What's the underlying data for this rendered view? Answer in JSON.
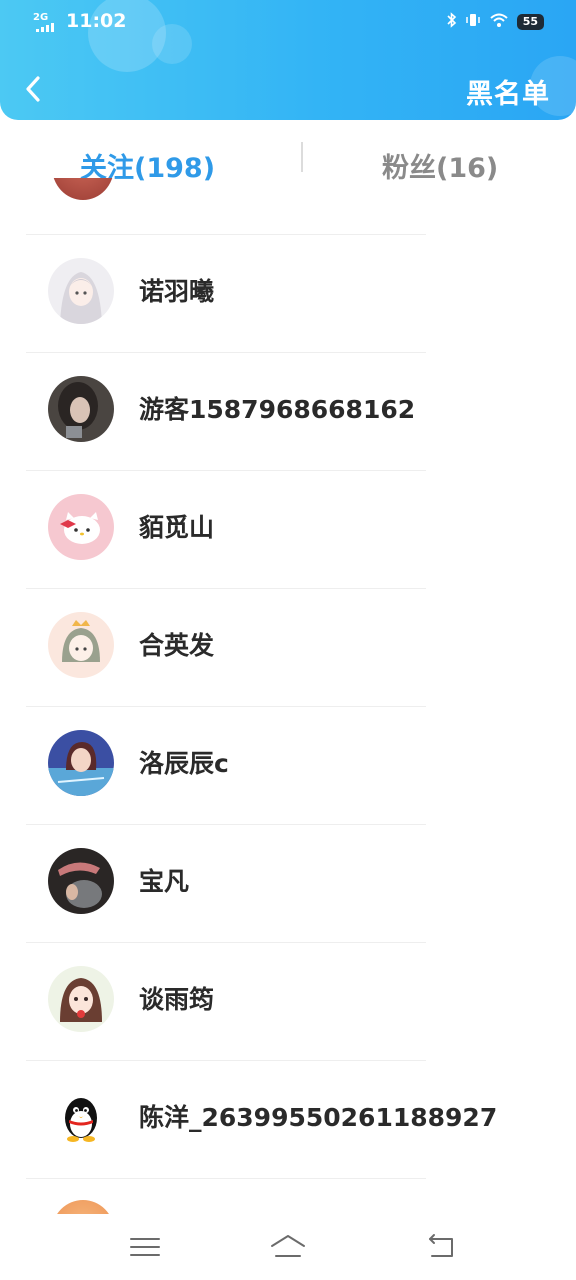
{
  "status_bar": {
    "network": "2G",
    "time": "11:02",
    "battery": "55",
    "icons": [
      "bluetooth-icon",
      "vibrate-icon",
      "wifi-icon",
      "battery-icon"
    ]
  },
  "header": {
    "back_icon": "chevron-left-icon",
    "blacklist_label": "黑名单"
  },
  "tabs": {
    "follow_label": "关注(198)",
    "fans_label": "粉丝(16)",
    "active": "follow"
  },
  "list": {
    "items": [
      {
        "name": "诺羽曦",
        "avatar": "anime-girl-white-hair"
      },
      {
        "name": "游客1587968668162",
        "avatar": "photo-girl-dark"
      },
      {
        "name": "貊觅山",
        "avatar": "hello-kitty"
      },
      {
        "name": "合英发",
        "avatar": "anime-girl-crown"
      },
      {
        "name": "洛辰辰c",
        "avatar": "anime-boy-blue"
      },
      {
        "name": "宝凡",
        "avatar": "photo-cap-dark"
      },
      {
        "name": "谈雨筠",
        "avatar": "anime-girl-brown-hair"
      },
      {
        "name": "陈洋_26399550261188927",
        "avatar": "qq-penguin"
      }
    ]
  },
  "nav": {
    "icons": [
      "menu-icon",
      "home-icon",
      "back-icon"
    ]
  },
  "colors": {
    "header_start": "#4cc9f3",
    "header_end": "#2aa6f4",
    "active_tab": "#2f9ae8",
    "inactive_tab": "#8a8a8a"
  }
}
